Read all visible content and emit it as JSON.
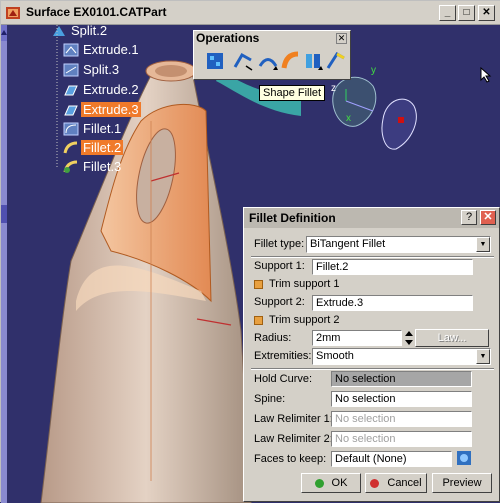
{
  "window": {
    "title": "Surface EX0101.CATPart"
  },
  "tree": {
    "items": [
      {
        "label": "Split.2",
        "selected": false
      },
      {
        "label": "Extrude.1",
        "selected": false
      },
      {
        "label": "Split.3",
        "selected": false
      },
      {
        "label": "Extrude.2",
        "selected": false
      },
      {
        "label": "Extrude.3",
        "selected": true
      },
      {
        "label": "Fillet.1",
        "selected": false
      },
      {
        "label": "Fillet.2",
        "selected": true
      },
      {
        "label": "Fillet.3",
        "selected": false
      }
    ]
  },
  "operations_toolbar": {
    "title": "Operations",
    "tooltip": "Shape Fillet"
  },
  "axes": {
    "z": "z",
    "x": "x",
    "y": "y"
  },
  "dialog": {
    "title": "Fillet Definition",
    "fillet_type_label": "Fillet type:",
    "fillet_type_value": "BiTangent Fillet",
    "support1_label": "Support 1:",
    "support1_value": "Fillet.2",
    "trim1_label": "Trim support 1",
    "support2_label": "Support 2:",
    "support2_value": "Extrude.3",
    "trim2_label": "Trim support 2",
    "radius_label": "Radius:",
    "radius_value": "2mm",
    "law_label": "Law...",
    "extremities_label": "Extremities:",
    "extremities_value": "Smooth",
    "hold_curve_label": "Hold Curve:",
    "hold_curve_value": "No selection",
    "spine_label": "Spine:",
    "spine_value": "No selection",
    "law_relimiter1_label": "Law Relimiter 1:",
    "law_relimiter1_value": "No selection",
    "law_relimiter2_label": "Law Relimiter 2:",
    "law_relimiter2_value": "No selection",
    "faces_label": "Faces to keep:",
    "faces_value": "Default (None)",
    "ok_label": "OK",
    "cancel_label": "Cancel",
    "preview_label": "Preview"
  },
  "colors": {
    "background": "#30306b",
    "selection": "#f07a2a",
    "part_surface": "#e8a27a",
    "cyan_surface": "#3aa5a5"
  }
}
